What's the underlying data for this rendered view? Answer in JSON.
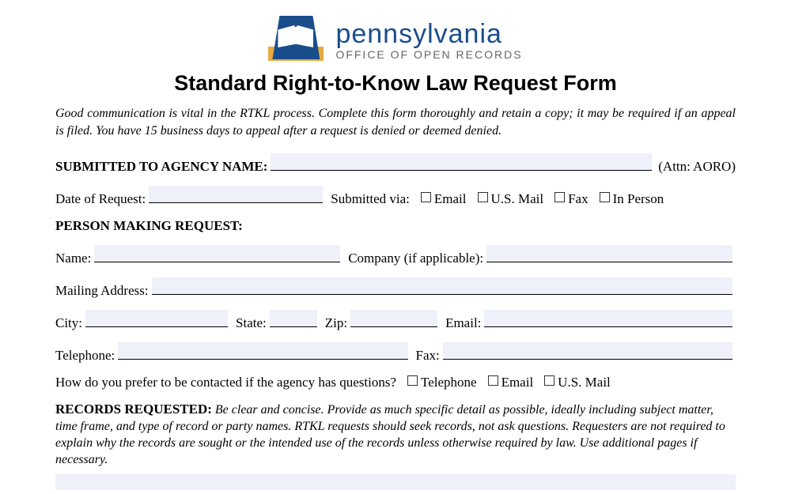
{
  "brand": {
    "name": "pennsylvania",
    "sub": "OFFICE OF OPEN RECORDS"
  },
  "title": "Standard Right-to-Know Law Request Form",
  "intro": "Good communication is vital in the RTKL process. Complete this form thoroughly and retain a copy; it may be required if an appeal is filed. You have 15 business days to appeal after a request is denied or deemed denied.",
  "agency": {
    "label": "SUBMITTED TO AGENCY NAME:",
    "attn": "(Attn: AORO)"
  },
  "date_row": {
    "date_label": "Date of Request:",
    "submitted_label": "Submitted via:",
    "options": [
      "Email",
      "U.S. Mail",
      "Fax",
      "In Person"
    ]
  },
  "person": {
    "heading": "PERSON MAKING REQUEST:",
    "name_label": "Name:",
    "company_label": "Company (if applicable):",
    "mailing_label": "Mailing Address:",
    "city_label": "City:",
    "state_label": "State:",
    "zip_label": "Zip:",
    "email_label": "Email:",
    "telephone_label": "Telephone:",
    "fax_label": "Fax:"
  },
  "contact_pref": {
    "question": "How do you prefer to be contacted if the agency has questions?",
    "options": [
      "Telephone",
      "Email",
      "U.S. Mail"
    ]
  },
  "records": {
    "label": "RECORDS REQUESTED:",
    "text": "Be clear and concise. Provide as much specific detail as possible, ideally including subject matter, time frame, and type of record or party names. RTKL requests should seek records, not ask questions. Requesters are not required to explain why the records are sought or the intended use of the records unless otherwise required by law. Use additional pages if necessary."
  }
}
